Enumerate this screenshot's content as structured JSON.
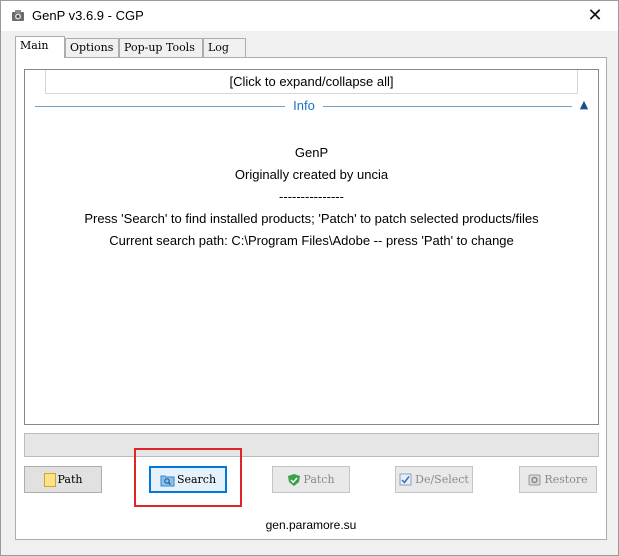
{
  "window": {
    "title": "GenP v3.6.9 - CGP",
    "close_glyph": "✕",
    "app_icon": "genp-app-icon"
  },
  "tabs": [
    {
      "label": "Main",
      "active": true
    },
    {
      "label": "Options",
      "active": false
    },
    {
      "label": "Pop-up Tools",
      "active": false
    },
    {
      "label": "Log",
      "active": false
    }
  ],
  "info_panel": {
    "expand_label": "[Click to expand/collapse all]",
    "group_title": "Info",
    "collapse_glyph": "▲",
    "lines": [
      "GenP",
      "Originally created by uncia",
      "---------------",
      "Press 'Search' to find installed products; 'Patch' to patch selected products/files",
      "Current search path: C:\\Program Files\\Adobe -- press 'Path' to change"
    ]
  },
  "progress": {
    "value": 0
  },
  "buttons": {
    "path": {
      "label": "Path",
      "icon": "folder-icon",
      "enabled": true
    },
    "search": {
      "label": "Search",
      "icon": "search-folder-icon",
      "enabled": true,
      "focused": true
    },
    "patch": {
      "label": "Patch",
      "icon": "shield-check-icon",
      "enabled": false
    },
    "deselect": {
      "label": "De/Select",
      "icon": "checkbox-icon",
      "enabled": false
    },
    "restore": {
      "label": "Restore",
      "icon": "restore-icon",
      "enabled": false
    }
  },
  "footer": {
    "link_text": "gen.paramore.su"
  },
  "colors": {
    "accent": "#0078d7",
    "group_title": "#1a73c8",
    "highlight": "#e0252b"
  }
}
